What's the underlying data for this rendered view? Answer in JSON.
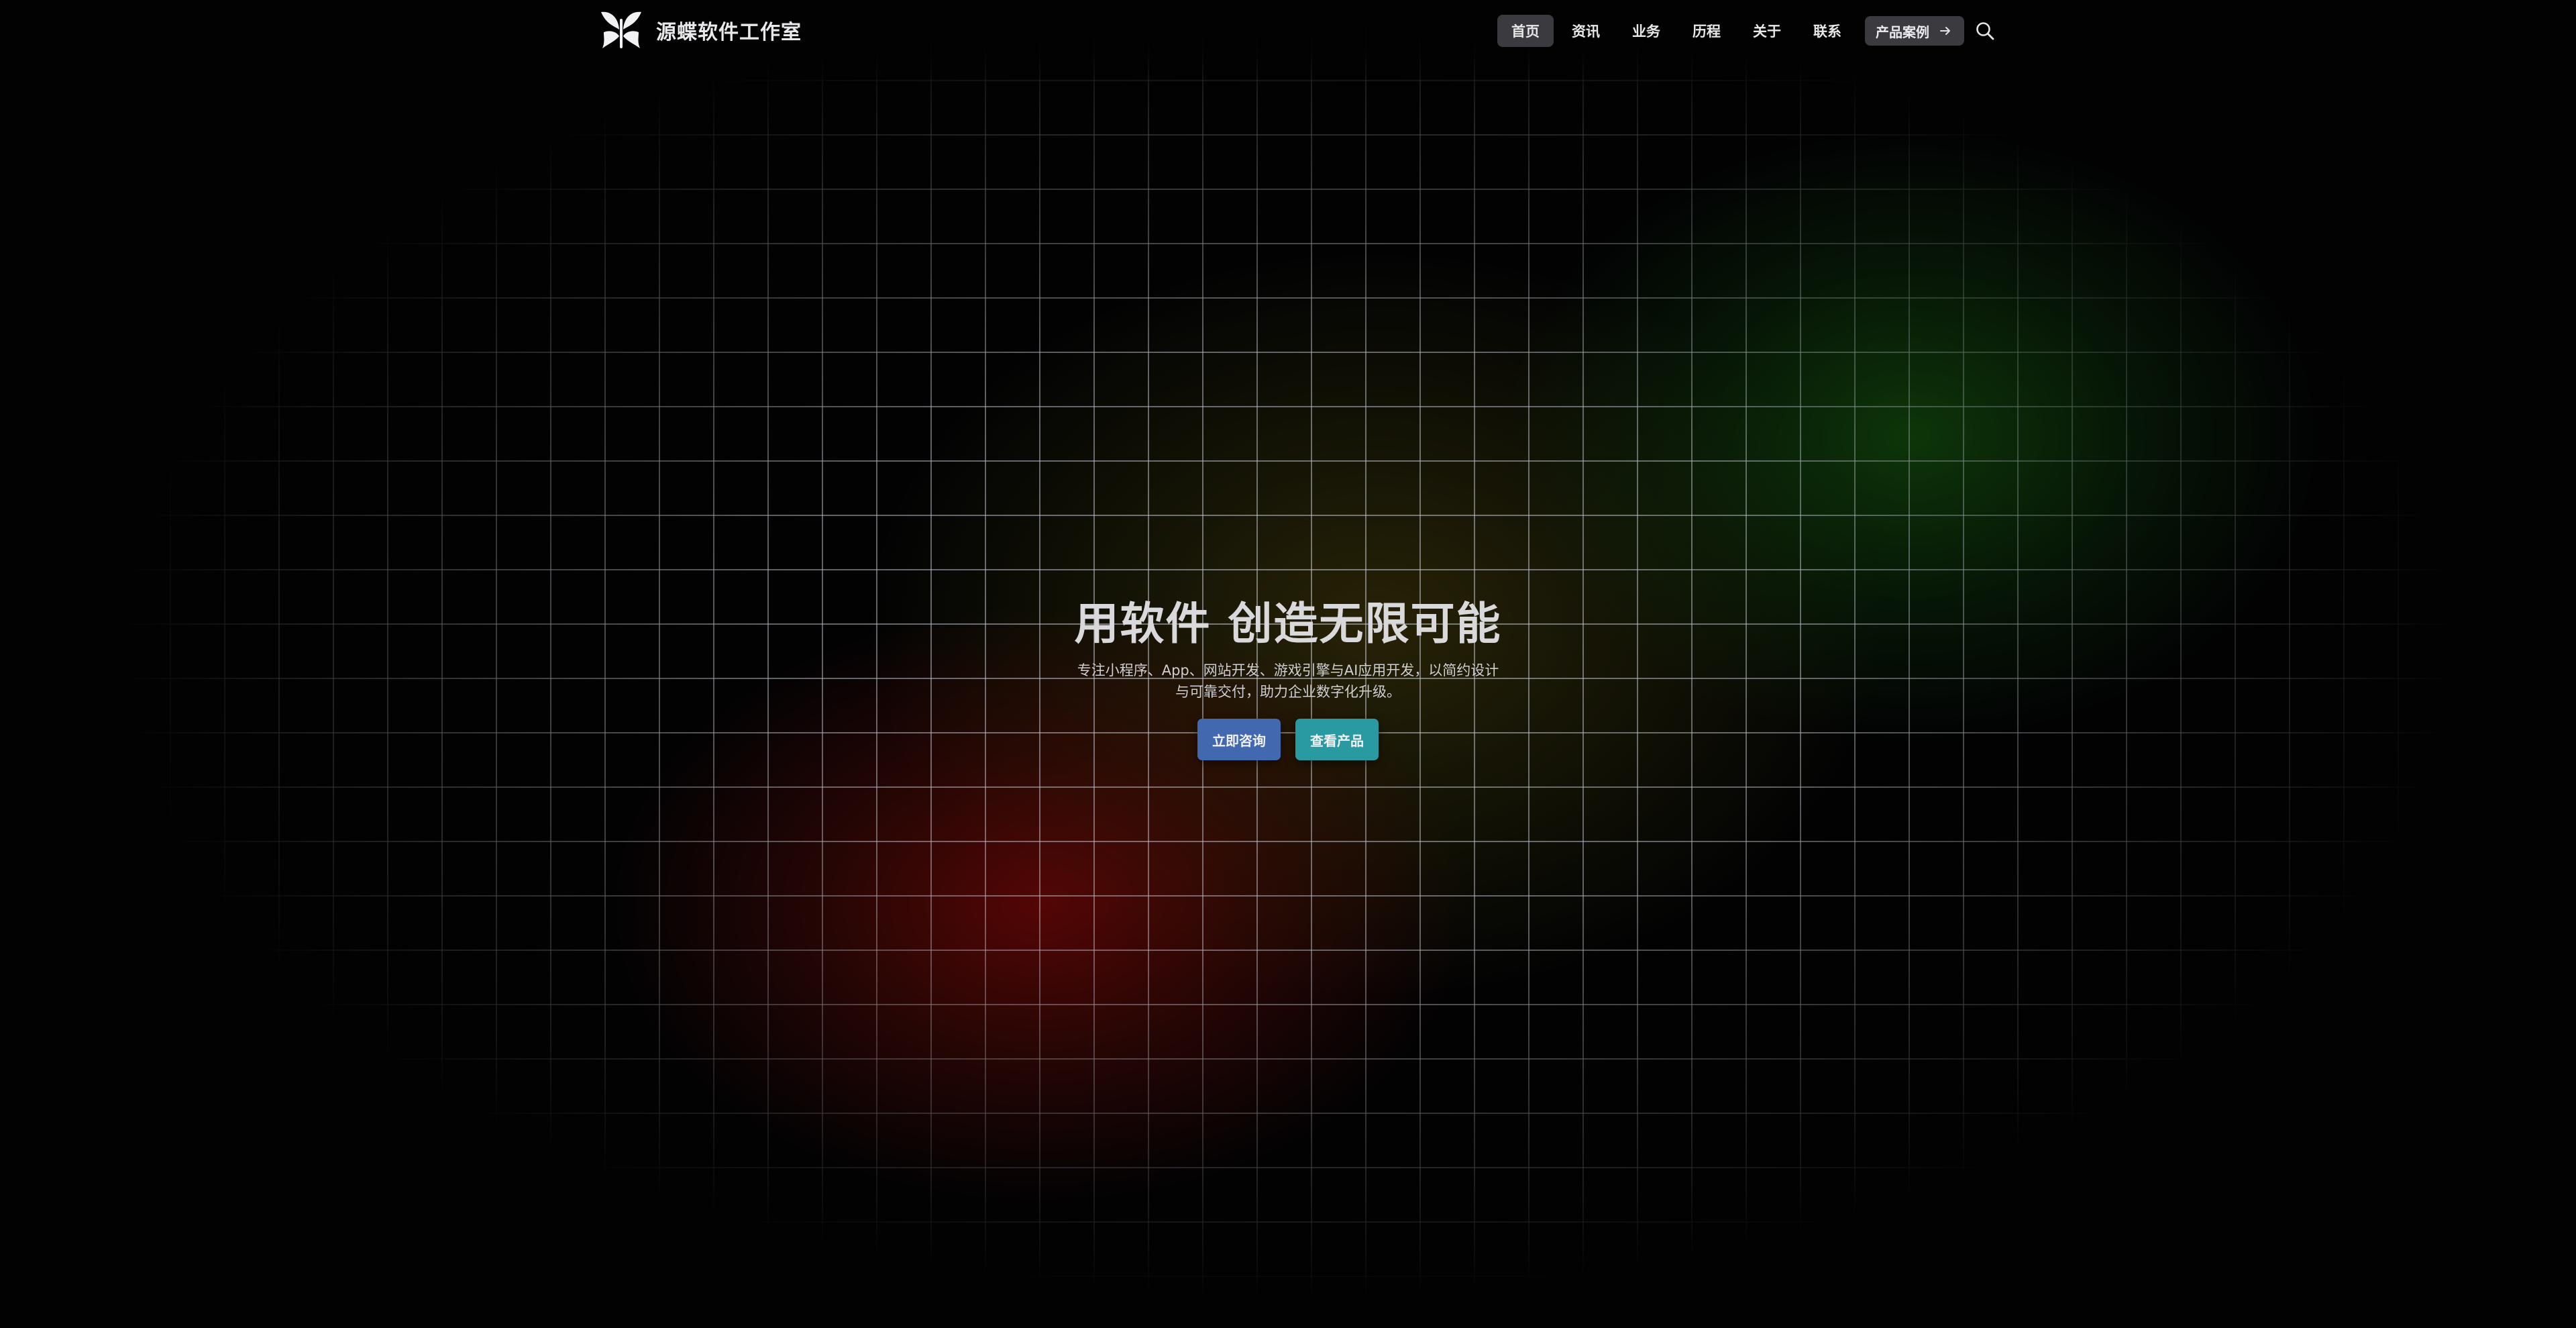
{
  "brand": {
    "name": "源蝶软件工作室",
    "logo_icon": "butterfly-icon"
  },
  "nav": {
    "items": [
      {
        "label": "首页",
        "active": true
      },
      {
        "label": "资讯",
        "active": false
      },
      {
        "label": "业务",
        "active": false
      },
      {
        "label": "历程",
        "active": false
      },
      {
        "label": "关于",
        "active": false
      },
      {
        "label": "联系",
        "active": false
      }
    ],
    "cta_label": "产品案例",
    "cta_icon": "arrow-right-icon",
    "search_icon": "search-icon"
  },
  "hero": {
    "title": "用软件 创造无限可能",
    "subtitle": "专注小程序、App、网站开发、游戏引擎与AI应用开发，以简约设计与可靠交付，助力企业数字化升级。",
    "primary_button": "立即咨询",
    "secondary_button": "查看产品"
  },
  "colors": {
    "background": "#020203",
    "primary_button": "#4268b0",
    "secondary_button": "#2a9aa2",
    "nav_active": "#3a3a3f",
    "glow_red": "#6e0806",
    "glow_olive": "#463c0a",
    "glow_green": "#124b0c"
  }
}
